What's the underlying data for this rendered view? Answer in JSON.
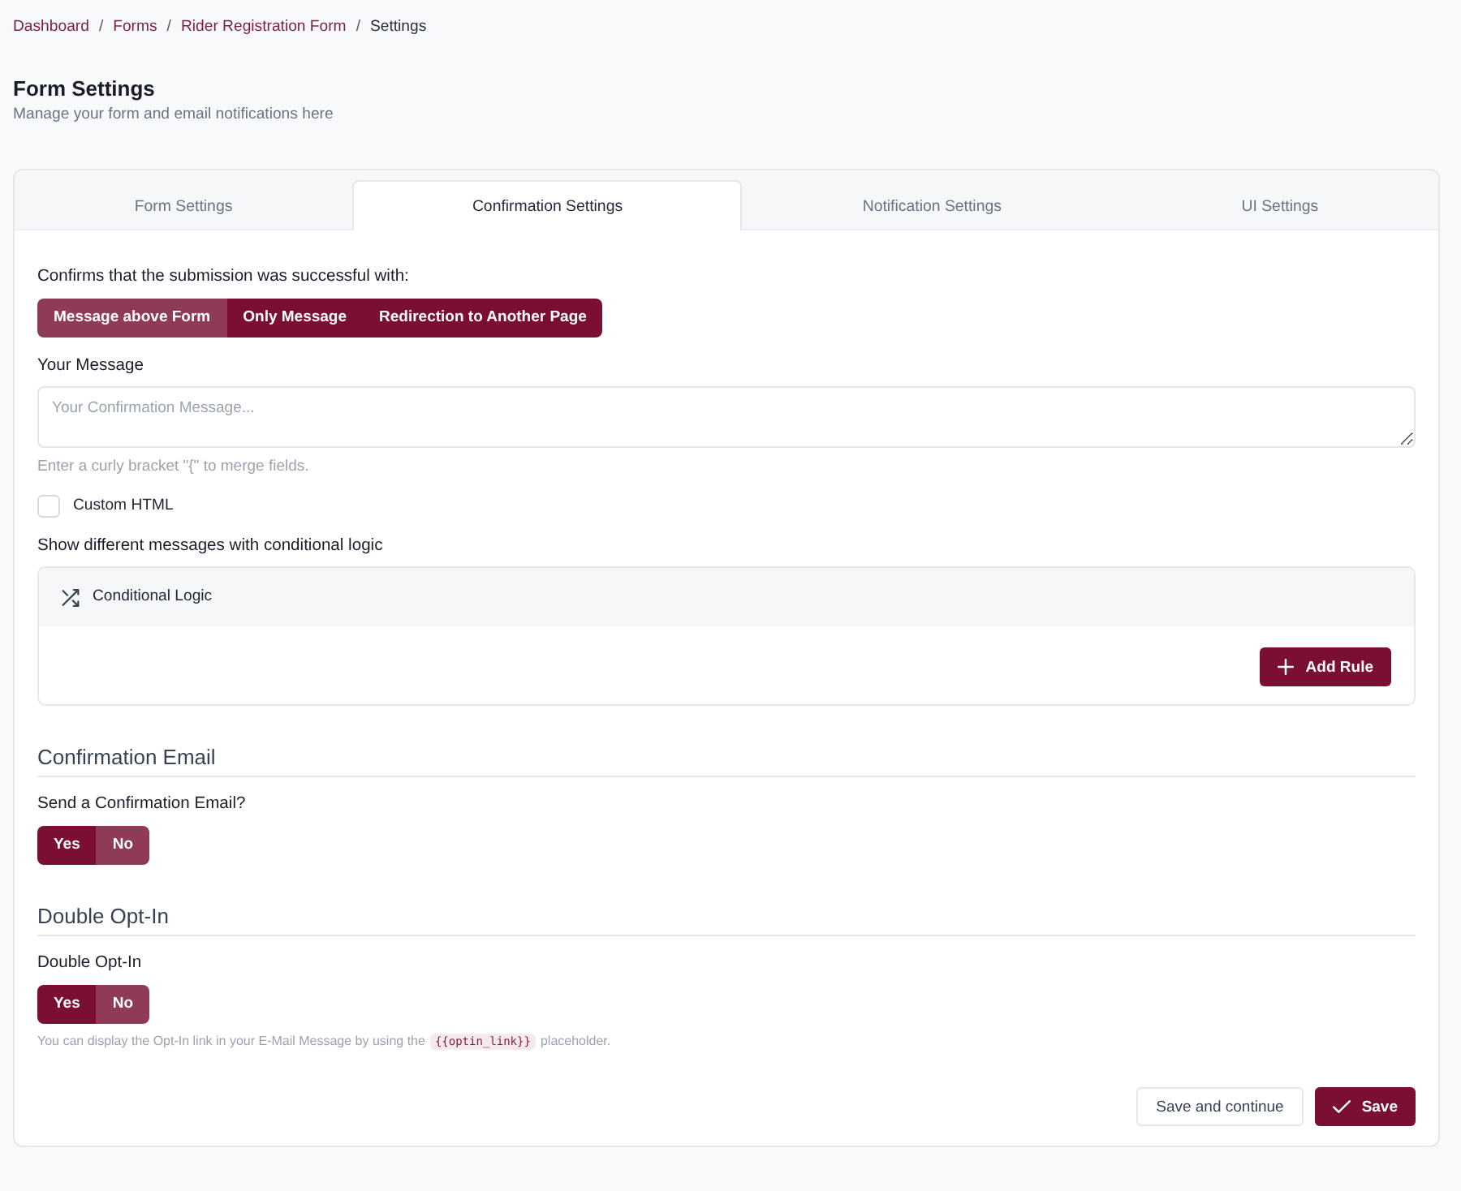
{
  "breadcrumb": {
    "separator": "/",
    "items": [
      {
        "label": "Dashboard",
        "kind": "link"
      },
      {
        "label": "Forms",
        "kind": "link"
      },
      {
        "label": "Rider Registration Form",
        "kind": "link"
      },
      {
        "label": "Settings",
        "kind": "current"
      }
    ]
  },
  "header": {
    "title": "Form Settings",
    "subtitle": "Manage your form and email notifications here"
  },
  "tabs": [
    {
      "label": "Form Settings",
      "selected": false
    },
    {
      "label": "Confirmation Settings",
      "selected": true
    },
    {
      "label": "Notification Settings",
      "selected": false
    },
    {
      "label": "UI Settings",
      "selected": false
    }
  ],
  "confirmation_type": {
    "label": "Confirms that the submission was successful with:",
    "options": [
      {
        "label": "Message above Form",
        "selected": true
      },
      {
        "label": "Only Message",
        "selected": false
      },
      {
        "label": "Redirection to Another Page",
        "selected": false
      }
    ]
  },
  "message": {
    "label": "Your Message",
    "placeholder": "Your Confirmation Message...",
    "hint": "Enter a curly bracket \"{\" to merge fields."
  },
  "custom_html": {
    "label": "Custom HTML",
    "checked": false
  },
  "conditional_logic": {
    "label": "Show different messages with conditional logic",
    "title": "Conditional Logic",
    "button": "Add Rule"
  },
  "sections": [
    {
      "title": "Confirmation Email",
      "field_label": "Send a Confirmation Email?",
      "options": [
        {
          "label": "Yes",
          "selected": false
        },
        {
          "label": "No",
          "selected": true
        }
      ]
    },
    {
      "title": "Double Opt-In",
      "field_label": "Double Opt-In",
      "options": [
        {
          "label": "Yes",
          "selected": false
        },
        {
          "label": "No",
          "selected": true
        }
      ],
      "note": {
        "before": "You can display the Opt-In link in your E-Mail Message by using the",
        "code": "{{optin_link}}",
        "after": "placeholder."
      }
    }
  ],
  "footer_buttons": [
    {
      "label": "Save and continue",
      "kind": "secondary"
    },
    {
      "label": "Save",
      "kind": "primary"
    }
  ]
}
